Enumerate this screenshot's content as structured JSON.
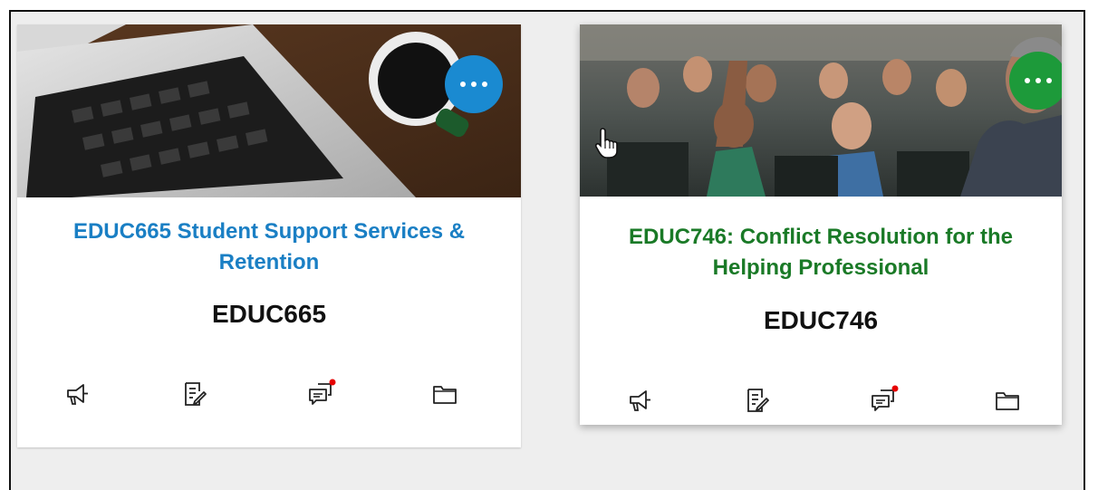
{
  "cards": [
    {
      "title": "EDUC665 Student Support Services & Retention",
      "code": "EDUC665",
      "accent": "#1a8ad1",
      "title_color": "#1a7fc4",
      "image": "laptop-coffee-photo"
    },
    {
      "title": "EDUC746: Conflict Resolution for the Helping Professional",
      "code": "EDUC746",
      "accent": "#1d9a3a",
      "title_color": "#1a7a27",
      "image": "classroom-lecture-photo"
    }
  ],
  "card_icons": [
    "announcements-icon",
    "assignments-icon",
    "discussions-icon",
    "files-icon"
  ],
  "discussion_badge_color": "#e60000"
}
